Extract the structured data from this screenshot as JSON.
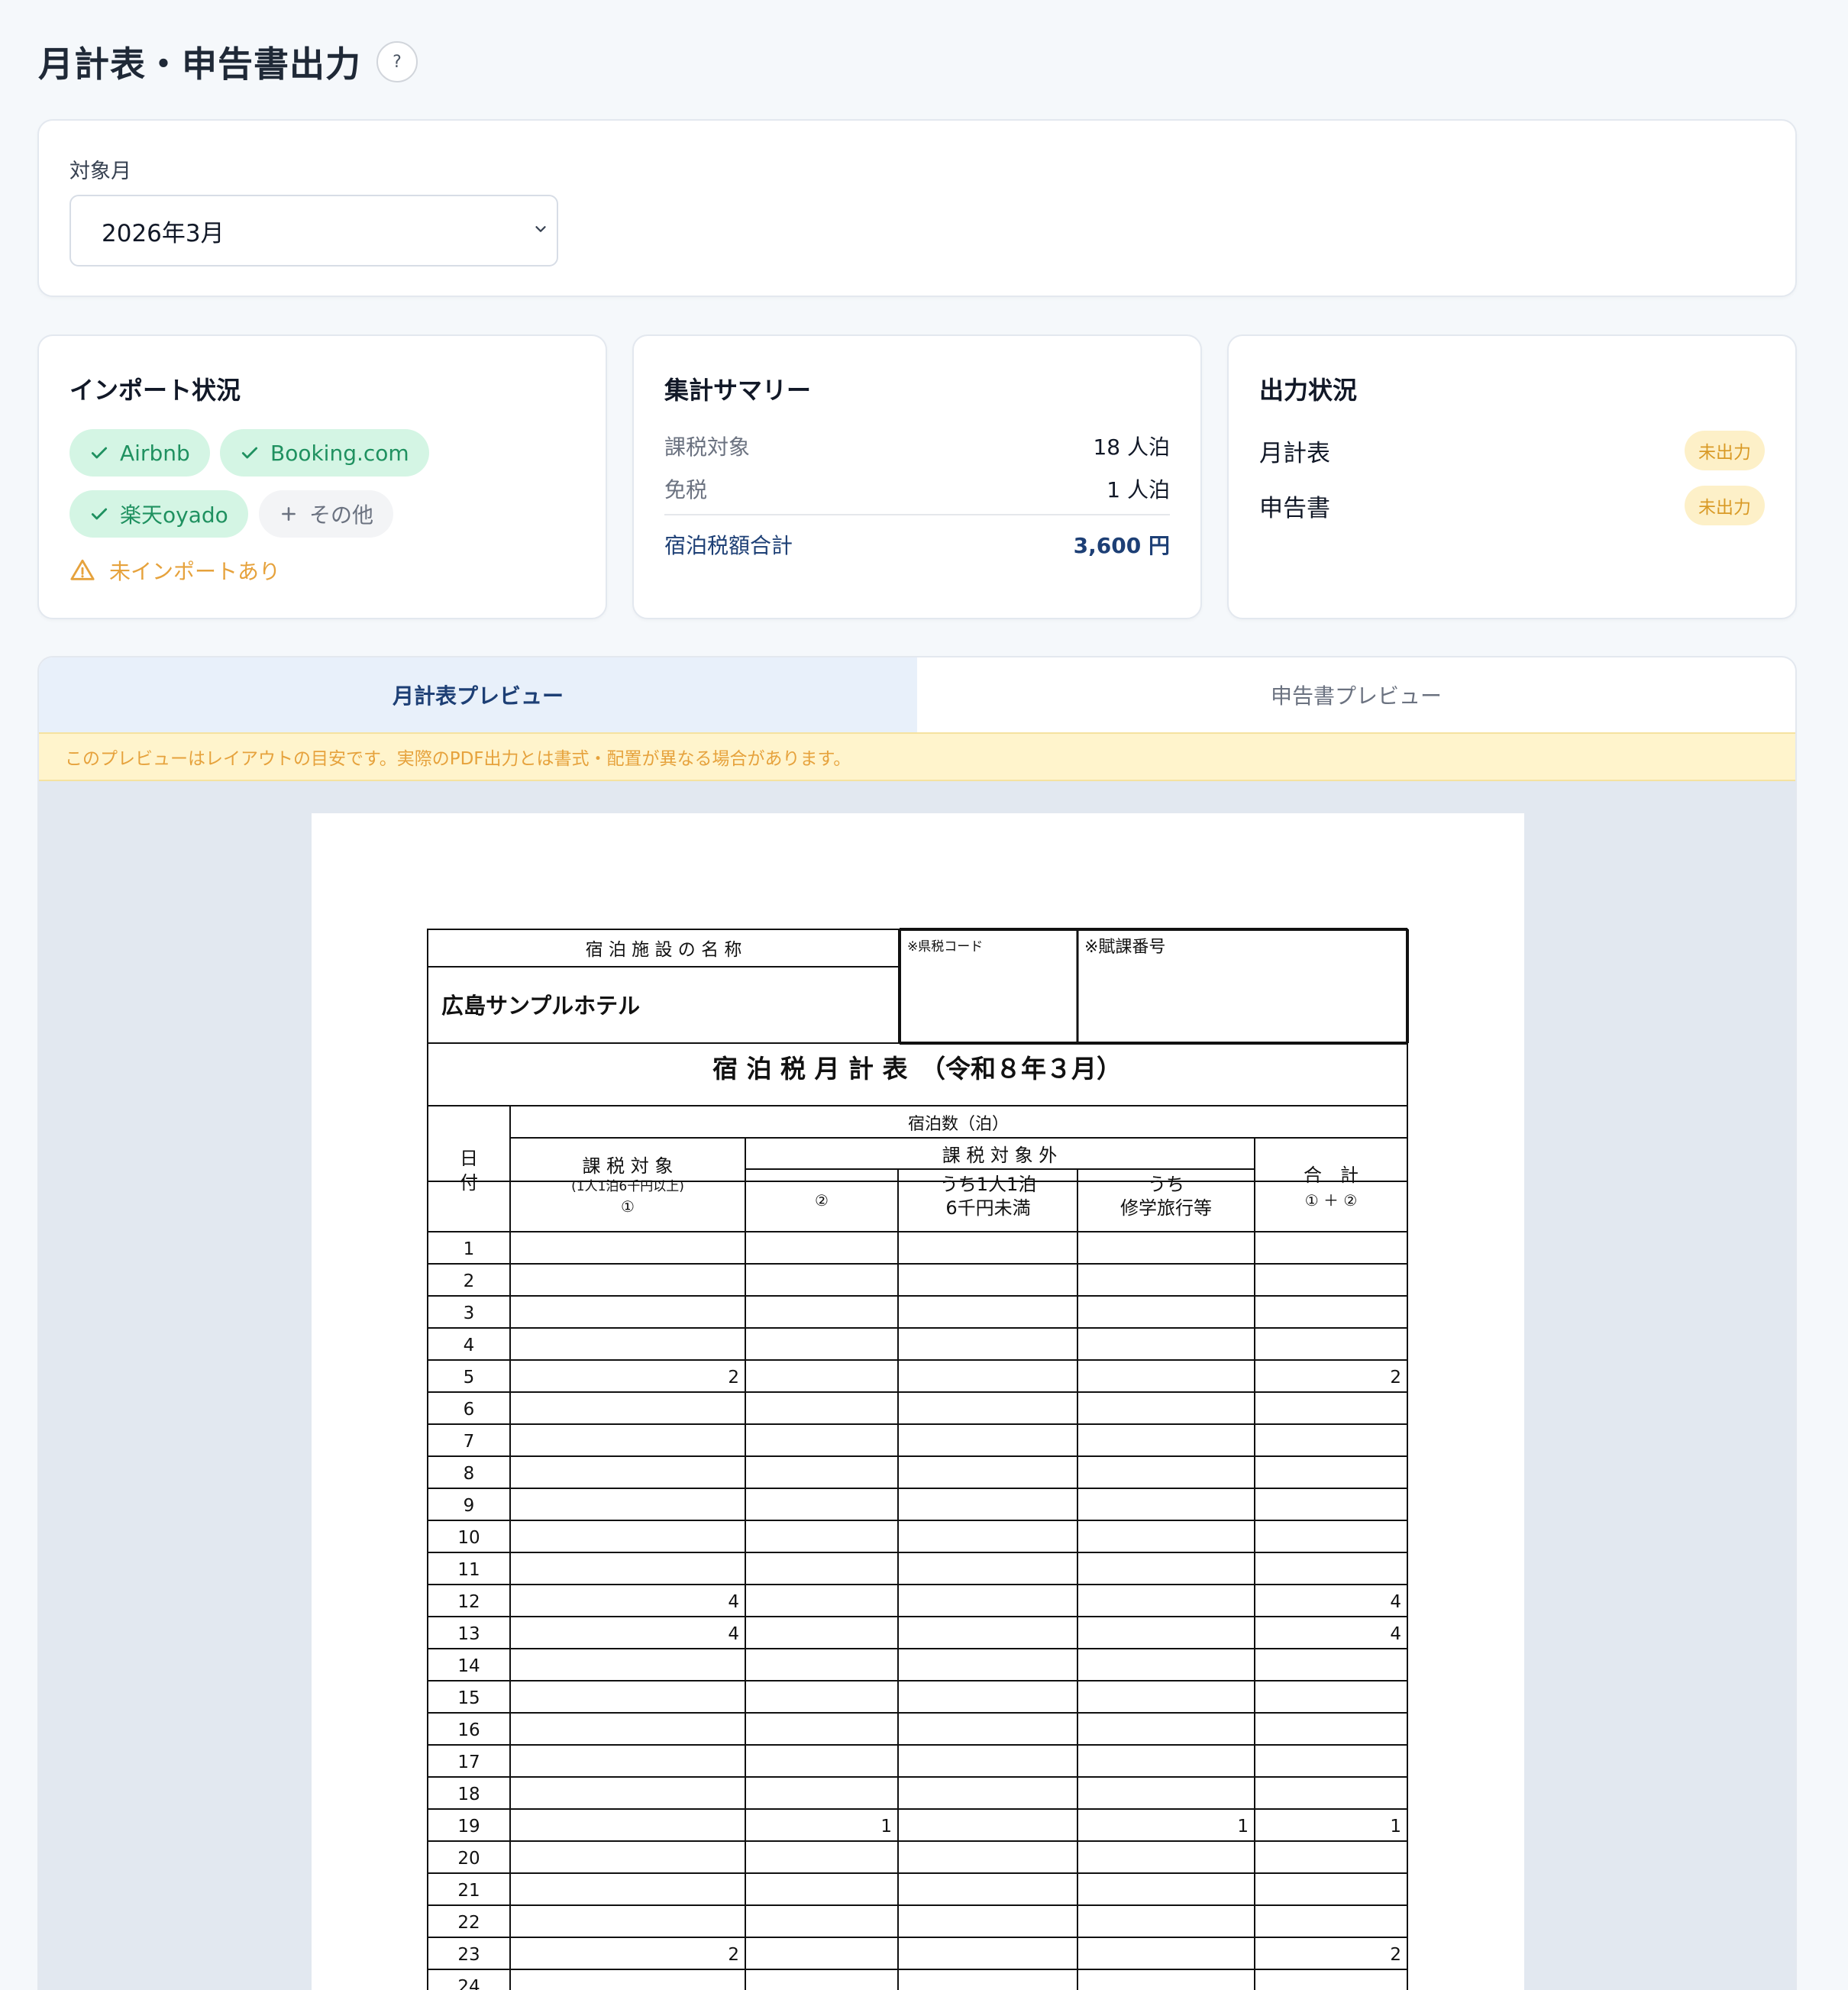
{
  "page": {
    "title": "月計表・申告書出力",
    "help_icon": "?"
  },
  "month": {
    "label": "対象月",
    "selected": "2026年3月"
  },
  "import_status": {
    "title": "インポート状況",
    "sources": [
      {
        "label": "Airbnb",
        "status": "imported"
      },
      {
        "label": "Booking.com",
        "status": "imported"
      },
      {
        "label": "楽天oyado",
        "status": "imported"
      },
      {
        "label": "その他",
        "status": "other"
      }
    ],
    "warning": "未インポートあり"
  },
  "summary": {
    "title": "集計サマリー",
    "rows": [
      {
        "label": "課税対象",
        "value": "18 人泊"
      },
      {
        "label": "免税",
        "value": "1 人泊"
      }
    ],
    "total": {
      "label": "宿泊税額合計",
      "value": "3,600 円"
    }
  },
  "output_status": {
    "title": "出力状況",
    "rows": [
      {
        "label": "月計表",
        "status": "未出力"
      },
      {
        "label": "申告書",
        "status": "未出力"
      }
    ]
  },
  "preview": {
    "tabs": [
      {
        "label": "月計表プレビュー",
        "active": true
      },
      {
        "label": "申告書プレビュー",
        "active": false
      }
    ],
    "notice": "このプレビューはレイアウトの目安です。実際のPDF出力とは書式・配置が異なる場合があります。"
  },
  "form": {
    "facility_header": "宿 泊 施 設 の 名 称",
    "facility_name": "広島サンプルホテル",
    "pref_code_label": "※県税コード",
    "tax_no_label": "※賦課番号",
    "title": "宿 泊 税 月 計 表　（令和８年３月）",
    "date_header": "日\n付",
    "nights_header": "宿泊数（泊）",
    "taxable_header": "課 税 対 象",
    "taxable_sub": "(1人1泊6千円以上)",
    "taxable_mark": "①",
    "nontaxable_header": "課 税 対 象 外",
    "nontaxable_mark": "②",
    "under6k": "うち1人1泊\n6千円未満",
    "school": "うち\n修学旅行等",
    "total_header": "合　計",
    "total_sub": "① ＋ ②",
    "rows": [
      {
        "day": "1",
        "taxable": "",
        "nontax": "",
        "under6k": "",
        "school": "",
        "total": ""
      },
      {
        "day": "2",
        "taxable": "",
        "nontax": "",
        "under6k": "",
        "school": "",
        "total": ""
      },
      {
        "day": "3",
        "taxable": "",
        "nontax": "",
        "under6k": "",
        "school": "",
        "total": ""
      },
      {
        "day": "4",
        "taxable": "",
        "nontax": "",
        "under6k": "",
        "school": "",
        "total": ""
      },
      {
        "day": "5",
        "taxable": "2",
        "nontax": "",
        "under6k": "",
        "school": "",
        "total": "2"
      },
      {
        "day": "6",
        "taxable": "",
        "nontax": "",
        "under6k": "",
        "school": "",
        "total": ""
      },
      {
        "day": "7",
        "taxable": "",
        "nontax": "",
        "under6k": "",
        "school": "",
        "total": ""
      },
      {
        "day": "8",
        "taxable": "",
        "nontax": "",
        "under6k": "",
        "school": "",
        "total": ""
      },
      {
        "day": "9",
        "taxable": "",
        "nontax": "",
        "under6k": "",
        "school": "",
        "total": ""
      },
      {
        "day": "10",
        "taxable": "",
        "nontax": "",
        "under6k": "",
        "school": "",
        "total": ""
      },
      {
        "day": "11",
        "taxable": "",
        "nontax": "",
        "under6k": "",
        "school": "",
        "total": ""
      },
      {
        "day": "12",
        "taxable": "4",
        "nontax": "",
        "under6k": "",
        "school": "",
        "total": "4"
      },
      {
        "day": "13",
        "taxable": "4",
        "nontax": "",
        "under6k": "",
        "school": "",
        "total": "4"
      },
      {
        "day": "14",
        "taxable": "",
        "nontax": "",
        "under6k": "",
        "school": "",
        "total": ""
      },
      {
        "day": "15",
        "taxable": "",
        "nontax": "",
        "under6k": "",
        "school": "",
        "total": ""
      },
      {
        "day": "16",
        "taxable": "",
        "nontax": "",
        "under6k": "",
        "school": "",
        "total": ""
      },
      {
        "day": "17",
        "taxable": "",
        "nontax": "",
        "under6k": "",
        "school": "",
        "total": ""
      },
      {
        "day": "18",
        "taxable": "",
        "nontax": "",
        "under6k": "",
        "school": "",
        "total": ""
      },
      {
        "day": "19",
        "taxable": "",
        "nontax": "1",
        "under6k": "",
        "school": "1",
        "total": "1"
      },
      {
        "day": "20",
        "taxable": "",
        "nontax": "",
        "under6k": "",
        "school": "",
        "total": ""
      },
      {
        "day": "21",
        "taxable": "",
        "nontax": "",
        "under6k": "",
        "school": "",
        "total": ""
      },
      {
        "day": "22",
        "taxable": "",
        "nontax": "",
        "under6k": "",
        "school": "",
        "total": ""
      },
      {
        "day": "23",
        "taxable": "2",
        "nontax": "",
        "under6k": "",
        "school": "",
        "total": "2"
      },
      {
        "day": "24",
        "taxable": "",
        "nontax": "",
        "under6k": "",
        "school": "",
        "total": ""
      }
    ]
  }
}
